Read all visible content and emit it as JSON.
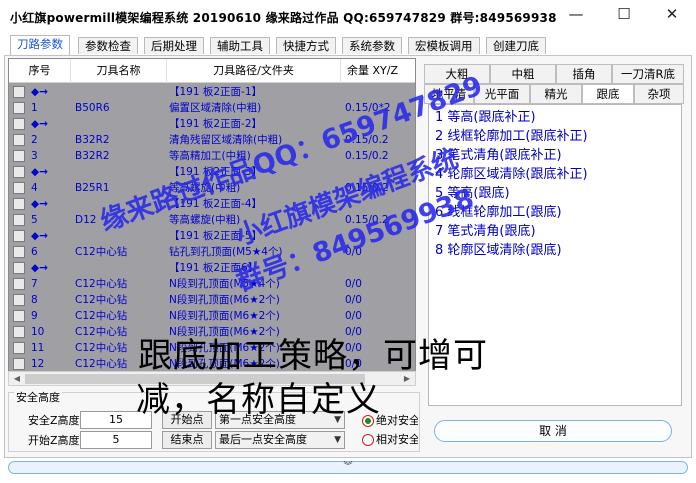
{
  "window": {
    "title": "小红旗powermill模架编程系统 20190610   缘来路过作品 QQ:659747829  群号:849569938",
    "minimize_glyph": "—",
    "maximize_glyph": "☐",
    "close_glyph": "✕"
  },
  "tabs": [
    {
      "label": "刀路参数",
      "active": true
    },
    {
      "label": "参数检查"
    },
    {
      "label": "后期处理"
    },
    {
      "label": "辅助工具"
    },
    {
      "label": "快捷方式"
    },
    {
      "label": "系统参数"
    },
    {
      "label": "宏模板调用"
    },
    {
      "label": "创建刀底"
    }
  ],
  "table": {
    "columns": [
      "序号",
      "刀具名称",
      "刀具路径/文件夹",
      "余量 XY/Z"
    ],
    "group_marker": "◆→",
    "rows": [
      {
        "kind": "group",
        "path": "【191 板2正面-1】"
      },
      {
        "kind": "item",
        "index": "1",
        "tool": "B50R6",
        "path": "偏置区域清除(中粗)",
        "stock": "0.15/0*2"
      },
      {
        "kind": "group",
        "path": "【191 板2正面-2】"
      },
      {
        "kind": "item",
        "index": "2",
        "tool": "B32R2",
        "path": "清角残留区域清除(中粗)",
        "stock": "0.15/0.2"
      },
      {
        "kind": "item",
        "index": "3",
        "tool": "B32R2",
        "path": "等高精加工(中粗)",
        "stock": "0.15/0.2"
      },
      {
        "kind": "group",
        "path": "【191 板2正面-3】"
      },
      {
        "kind": "item",
        "index": "4",
        "tool": "B25R1",
        "path": "等高螺旋(中粗)",
        "stock": "0.15/0.2"
      },
      {
        "kind": "group",
        "path": "【191 板2正面-4】"
      },
      {
        "kind": "item",
        "index": "5",
        "tool": "D12",
        "path": "等高螺旋(中粗)",
        "stock": "0.15/0.2"
      },
      {
        "kind": "group",
        "path": "【191 板2正面-5】"
      },
      {
        "kind": "item",
        "index": "6",
        "tool": "C12中心钻",
        "path": "钻孔到孔顶面(M5★4个)",
        "stock": "0/0"
      },
      {
        "kind": "group",
        "path": "【191 板2正面6】"
      },
      {
        "kind": "item",
        "index": "7",
        "tool": "C12中心钻",
        "path": "N段到孔顶面(M5★4个)",
        "stock": "0/0"
      },
      {
        "kind": "item",
        "index": "8",
        "tool": "C12中心钻",
        "path": "N段到孔顶面(M6★2个)",
        "stock": "0/0"
      },
      {
        "kind": "item",
        "index": "9",
        "tool": "C12中心钻",
        "path": "N段到孔顶面(M6★2个)",
        "stock": "0/0"
      },
      {
        "kind": "item",
        "index": "10",
        "tool": "C12中心钻",
        "path": "N段到孔顶面(M6★2个)",
        "stock": "0/0"
      },
      {
        "kind": "item",
        "index": "11",
        "tool": "C12中心钻",
        "path": "N段到孔顶面(M6★2个)",
        "stock": "0/0"
      },
      {
        "kind": "item",
        "index": "12",
        "tool": "C12中心钻",
        "path": "N段到孔顶面(M6★2个)",
        "stock": "0/0"
      }
    ]
  },
  "safety": {
    "group_label": "安全高度",
    "safe_z_label": "安全Z高度",
    "safe_z_value": "15",
    "start_z_label": "开始Z高度",
    "start_z_value": "5",
    "start_point_label": "开始点",
    "start_point_value": "第一点安全高度",
    "end_point_label": "结束点",
    "end_point_value": "最后一点安全高度",
    "absolute_label": "绝对安全",
    "relative_label": "相对安全"
  },
  "right_panel": {
    "tabs_row1": [
      "大粗",
      "中粗",
      "插角",
      "一刀清R底"
    ],
    "tabs_row2": [
      "地平清",
      "光平面",
      "精光",
      "跟底",
      "杂项"
    ],
    "active_tab": "跟底",
    "strategies": [
      "1 等高(跟底补正)",
      "2 线框轮廓加工(跟底补正)",
      "3 笔式清角(跟底补正)",
      "4 轮廓区域清除(跟底补正)",
      "5 等高(跟底)",
      "6 线框轮廓加工(跟底)",
      "7 笔式清角(跟底)",
      "8 轮廓区域清除(跟底)"
    ],
    "cancel_label": "取 消"
  },
  "footer": {
    "expand_glyph": "︾"
  },
  "watermark": {
    "line1": "缘来路过作品QQ：659747829",
    "line2": "小红旗模架编程系统",
    "line3": "群号：849569938"
  },
  "caption": {
    "line1": "跟底加工策略，可增可",
    "line2": "减，名称自定义"
  },
  "colors": {
    "accent_blue": "#1a55d0",
    "watermark_blue": "#2828eb",
    "list_bg": "#a0a0a4"
  }
}
